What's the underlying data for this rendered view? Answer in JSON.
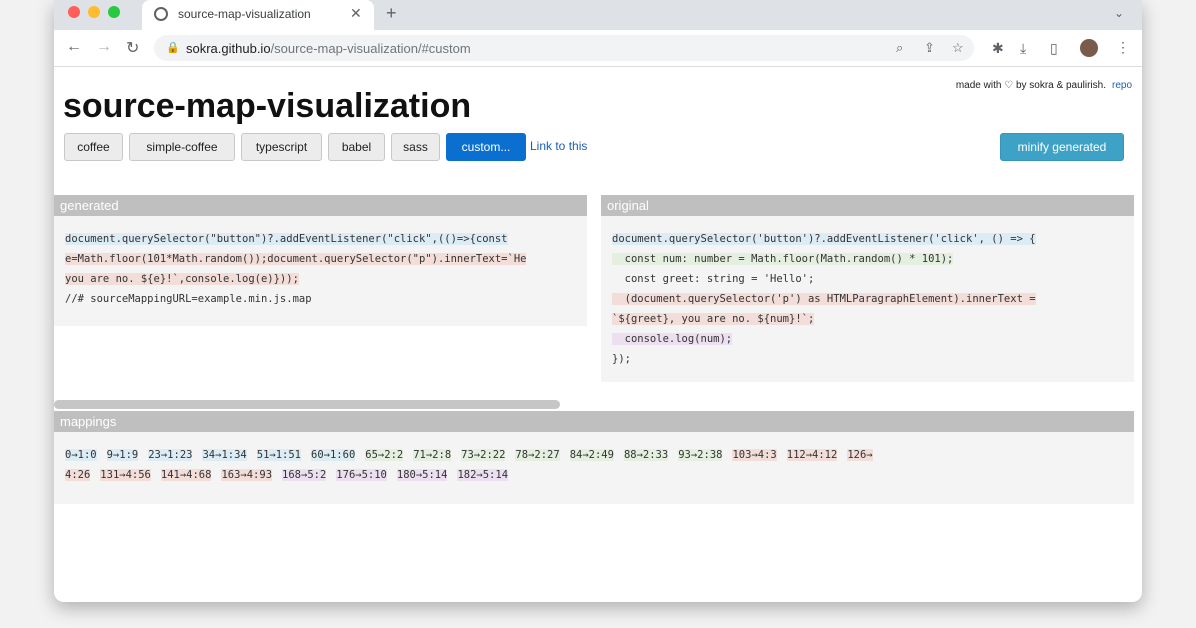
{
  "browser": {
    "tab_title": "source-map-visualization",
    "tab_close": "✕",
    "new_tab": "+",
    "url_host": "sokra.github.io",
    "url_path": "/source-map-visualization/#custom"
  },
  "page": {
    "title": "source-map-visualization",
    "credits_text": "made with ♡ by sokra & paulirish.",
    "repo_link": "repo",
    "examples": [
      {
        "label": "coffee",
        "active": false
      },
      {
        "label": "simple-coffee",
        "active": false
      },
      {
        "label": "typescript",
        "active": false
      },
      {
        "label": "babel",
        "active": false
      },
      {
        "label": "sass",
        "active": false
      },
      {
        "label": "custom...",
        "active": true
      }
    ],
    "link_this": "Link to this",
    "minify_button": "minify generated"
  },
  "generated": {
    "header": "generated",
    "lines": [
      "document.querySelector(\"button\")?.addEventListener(\"click\",(()=>{const",
      "e=Math.floor(101*Math.random());document.querySelector(\"p\").innerText=`He",
      "you are no. ${e}!`,console.log(e)}));",
      "//# sourceMappingURL=example.min.js.map"
    ]
  },
  "original": {
    "header": "original",
    "lines": [
      "document.querySelector('button')?.addEventListener('click', () => {",
      "  const num: number = Math.floor(Math.random() * 101);",
      "  const greet: string = 'Hello';",
      "  (document.querySelector('p') as HTMLParagraphElement).innerText =",
      "`${greet}, you are no. ${num}!`;",
      "  console.log(num);",
      "});"
    ]
  },
  "mappings": {
    "header": "mappings",
    "row1": [
      {
        "text": "0→1:0",
        "color": "blue"
      },
      {
        "text": "9→1:9",
        "color": "blue"
      },
      {
        "text": "23→1:23",
        "color": "blue"
      },
      {
        "text": "34→1:34",
        "color": "blue"
      },
      {
        "text": "51→1:51",
        "color": "blue"
      },
      {
        "text": "60→1:60",
        "color": "blue"
      },
      {
        "text": "65→2:2",
        "color": "green"
      },
      {
        "text": "71→2:8",
        "color": "green"
      },
      {
        "text": "73→2:22",
        "color": "green"
      },
      {
        "text": "78→2:27",
        "color": "green"
      },
      {
        "text": "84→2:49",
        "color": "green"
      },
      {
        "text": "88→2:33",
        "color": "green"
      },
      {
        "text": "93→2:38",
        "color": "green"
      },
      {
        "text": "103→4:3",
        "color": "red"
      },
      {
        "text": "112→4:12",
        "color": "red"
      },
      {
        "text": "126→",
        "color": "red"
      }
    ],
    "row2": [
      {
        "text": "4:26",
        "color": "red"
      },
      {
        "text": "131→4:56",
        "color": "red"
      },
      {
        "text": "141→4:68",
        "color": "red"
      },
      {
        "text": "163→4:93",
        "color": "red"
      },
      {
        "text": "168→5:2",
        "color": "purple"
      },
      {
        "text": "176→5:10",
        "color": "purple"
      },
      {
        "text": "180→5:14",
        "color": "purple"
      },
      {
        "text": "182→5:14",
        "color": "purple"
      }
    ]
  },
  "colors": {
    "blue": "#dcecf5",
    "green": "#e5efe0",
    "red": "#f3ddd9",
    "purple": "#ece0f0",
    "accent": "#0a6fcf",
    "minify": "#3ea2c7"
  }
}
